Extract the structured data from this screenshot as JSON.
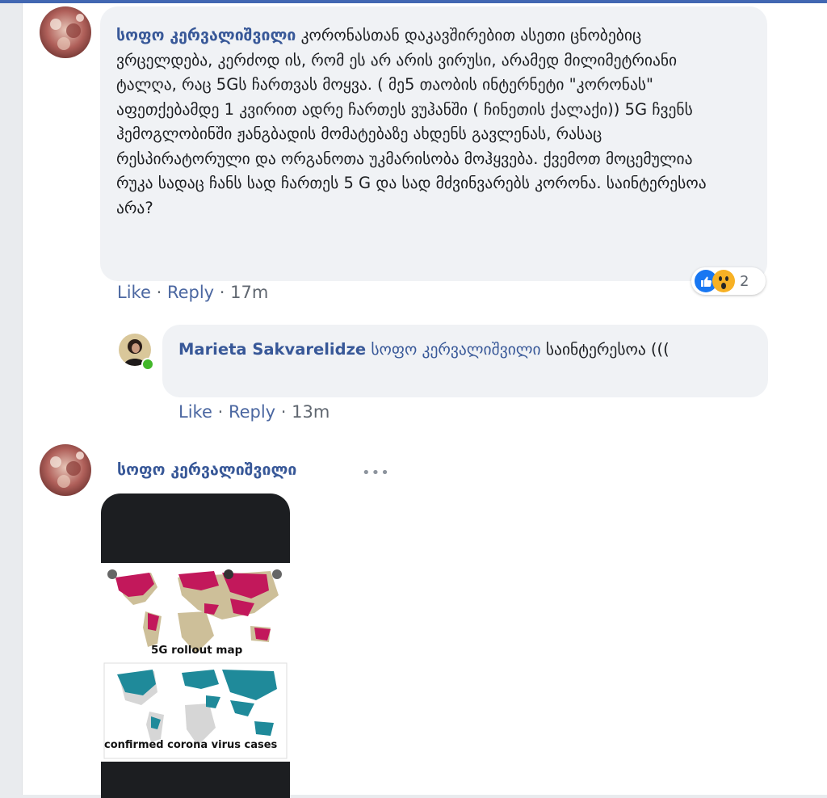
{
  "comment1": {
    "author": "სოფო კერვალიშვილი",
    "text": "კორონასთან დაკავშირებით ასეთი ცნობებიც ვრცელდება, კერძოდ ის, რომ ეს არ არის ვირუსი, არამედ მილიმეტრიანი ტალღა, რაც 5Gს ჩართვას მოყვა. ( მე5 თაობის ინტერნეტი \"კორონას\" აფეთქებამდე 1 კვირით ადრე ჩართეს ვუჰანში ( ჩინეთის ქალაქი)) 5G ჩვენს ჰემოგლობინში ჟანგბადის მომატებაზე ახდენს გავლენას, რასაც რესპირატორული და ორგანოთა უკმარისობა მოჰყვება. ქვემოთ მოცემულია რუკა სადაც ჩანს სად ჩართეს 5 G და სად მძვინვარებს კორონა. საინტერესოა არა?",
    "like": "Like",
    "sep": "·",
    "reply": "Reply",
    "time": "17m",
    "reaction_count": "2",
    "reaction_icons": [
      "like-icon",
      "wow-icon"
    ]
  },
  "reply1": {
    "author": "Marieta Sakvarelidze",
    "mention": "სოფო კერვალიშვილი",
    "text": "საინტერესოა (((",
    "like": "Like",
    "sep": "·",
    "reply": "Reply",
    "time": "13m"
  },
  "comment2": {
    "author": "სოფო კერვალიშვილი",
    "more": "•••",
    "image": {
      "caption_top": "5G rollout map",
      "caption_bottom": "confirmed corona virus cases"
    }
  },
  "colors": {
    "link": "#385898",
    "bubble": "#f0f2f5",
    "map_5g": "#c2185b",
    "map_corona": "#1f8a9a"
  }
}
